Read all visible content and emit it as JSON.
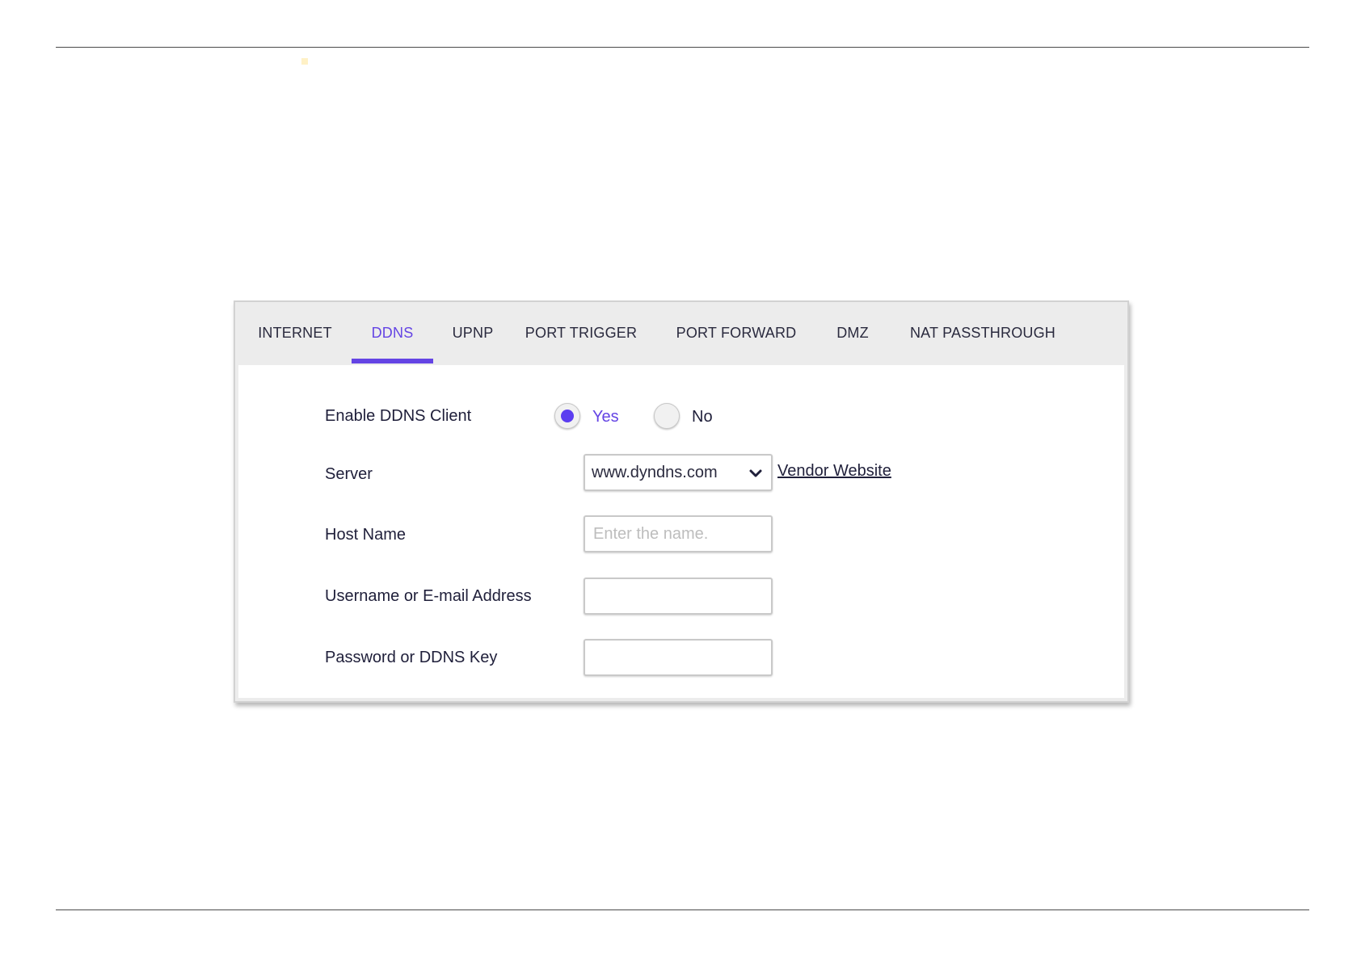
{
  "tabs": [
    {
      "label": "INTERNET",
      "active": false
    },
    {
      "label": "DDNS",
      "active": true
    },
    {
      "label": "UPNP",
      "active": false
    },
    {
      "label": "PORT TRIGGER",
      "active": false
    },
    {
      "label": "PORT FORWARD",
      "active": false
    },
    {
      "label": "DMZ",
      "active": false
    },
    {
      "label": "NAT PASSTHROUGH",
      "active": false
    }
  ],
  "form": {
    "enable_label": "Enable DDNS Client",
    "enable_options": {
      "yes": "Yes",
      "no": "No",
      "selected": "Yes"
    },
    "server_label": "Server",
    "server_value": "www.dyndns.com",
    "vendor_link": "Vendor Website",
    "host_label": "Host Name",
    "host_placeholder": "Enter the name.",
    "host_value": "",
    "username_label": "Username or E-mail Address",
    "username_value": "",
    "password_label": "Password or DDNS Key",
    "password_value": ""
  },
  "icons": {
    "server_dropdown": "chevron-down-icon"
  },
  "colors": {
    "accent": "#6444e4",
    "radio_selected": "#5b3df0",
    "tab_bar_bg": "#ececec",
    "text": "#1f1f3a"
  }
}
